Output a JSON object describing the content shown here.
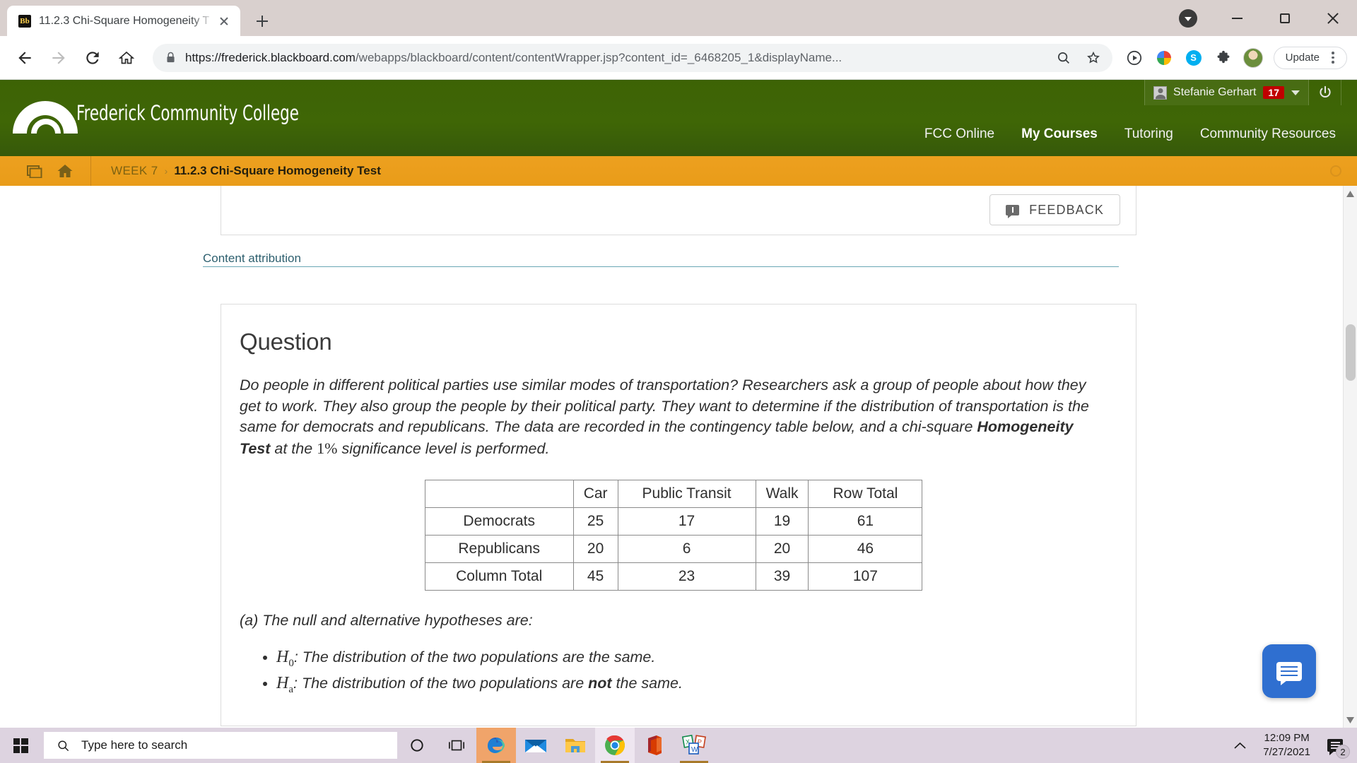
{
  "browser": {
    "tab": {
      "title": "11.2.3 Chi-Square Homogeneity T",
      "favicon_label": "Bb",
      "favicon_name": "blackboard-favicon"
    },
    "newtab_label": "+",
    "url_scheme": "https://",
    "url_host": "frederick.blackboard.com",
    "url_path": "/webapps/blackboard/content/contentWrapper.jsp?content_id=_6468205_1&displayName...",
    "update_label": "Update",
    "icons": [
      "back-icon",
      "forward-icon",
      "reload-icon",
      "home-icon",
      "lock-icon",
      "zoom-icon",
      "bookmark-star-icon",
      "media-play-icon",
      "grammarly-icon",
      "skype-icon",
      "extensions-puzzle-icon",
      "profile-avatar-icon",
      "kebab-menu-icon"
    ]
  },
  "blackboard": {
    "logo_text": "Frederick Community College",
    "user": {
      "name": "Stefanie Gerhart",
      "badge_count": "17"
    },
    "nav": [
      {
        "label": "FCC Online",
        "active": false
      },
      {
        "label": "My Courses",
        "active": true
      },
      {
        "label": "Tutoring",
        "active": false
      },
      {
        "label": "Community Resources",
        "active": false
      }
    ],
    "breadcrumb": {
      "parent": "WEEK 7",
      "separator": "›",
      "current": "11.2.3 Chi-Square Homogeneity Test"
    }
  },
  "content": {
    "feedback_label": "FEEDBACK",
    "attribution_label": "Content attribution",
    "question_title": "Question",
    "question_text_1": "Do people in different political parties use similar modes of transportation? Researchers ask a group of people about how they get to work. They also group the people by their political party. They want to determine if the distribution of transportation is the same for democrats and republicans. The data are recorded in the contingency table below, and a chi-square ",
    "question_bold": "Homogeneity Test",
    "question_text_2": " at the ",
    "question_math": "1%",
    "question_text_3": " significance level is performed.",
    "part_a_label": "(a)  The null and alternative hypotheses are:",
    "hypotheses": [
      {
        "symbol": "H",
        "sub": "0",
        "text": ": The distribution of the two populations are the same.",
        "bold_word": ""
      },
      {
        "symbol": "H",
        "sub": "a",
        "text_before": ": The distribution of the two populations are ",
        "bold_word": "not",
        "text_after": " the same."
      }
    ]
  },
  "chart_data": {
    "type": "table",
    "title": "Contingency table: transportation mode by political party",
    "columns": [
      "",
      "Car",
      "Public Transit",
      "Walk",
      "Row Total"
    ],
    "rows": [
      {
        "label": "Democrats",
        "values": [
          "25",
          "17",
          "19",
          "61"
        ]
      },
      {
        "label": "Republicans",
        "values": [
          "20",
          "6",
          "20",
          "46"
        ]
      },
      {
        "label": "Column Total",
        "values": [
          "45",
          "23",
          "39",
          "107"
        ]
      }
    ]
  },
  "taskbar": {
    "search_placeholder": "Type here to search",
    "apps": [
      "edge-icon",
      "mail-icon",
      "file-explorer-icon",
      "chrome-icon",
      "office-icon",
      "office-apps-icon"
    ],
    "clock_time": "12:09 PM",
    "clock_date": "7/27/2021",
    "notification_count": "2"
  },
  "colors": {
    "brand_green": "#3f6606",
    "breadcrumb_orange": "#e99c19",
    "badge_red": "#c00000",
    "link_teal": "#2d5f6e",
    "chat_blue": "#2f6fd0"
  }
}
